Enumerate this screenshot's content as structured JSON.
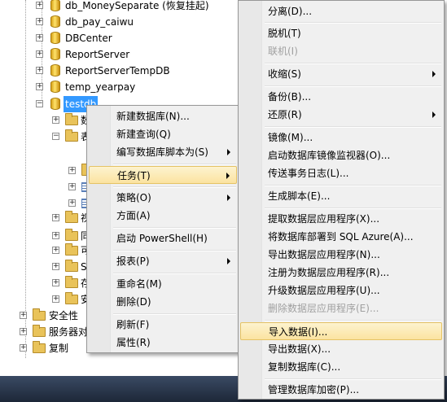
{
  "tree": {
    "items": [
      {
        "label": "db_MoneySeparate (恢复挂起)",
        "kind": "db"
      },
      {
        "label": "db_pay_caiwu",
        "kind": "db"
      },
      {
        "label": "DBCenter",
        "kind": "db"
      },
      {
        "label": "ReportServer",
        "kind": "db"
      },
      {
        "label": "ReportServerTempDB",
        "kind": "db"
      },
      {
        "label": "temp_yearpay",
        "kind": "db"
      },
      {
        "label": "testdb",
        "kind": "db"
      }
    ],
    "children": [
      "数",
      "表",
      "",
      "",
      "",
      "视",
      "同",
      "可",
      "S",
      "存",
      "安"
    ],
    "roots": [
      "安全性",
      "服务器对",
      "复制"
    ],
    "expand_plus": "+",
    "expand_minus": "−",
    "partial_right": "9"
  },
  "context_menu": {
    "items": [
      {
        "label": "新建数据库(N)..."
      },
      {
        "label": "新建查询(Q)"
      },
      {
        "label": "编写数据库脚本为(S)",
        "submenu": true
      },
      {
        "label": "任务(T)",
        "submenu": true,
        "highlighted": true
      },
      {
        "label": "策略(O)",
        "submenu": true
      },
      {
        "label": "方面(A)"
      },
      {
        "label": "启动 PowerShell(H)"
      },
      {
        "label": "报表(P)",
        "submenu": true
      },
      {
        "label": "重命名(M)"
      },
      {
        "label": "删除(D)"
      },
      {
        "label": "刷新(F)"
      },
      {
        "label": "属性(R)"
      }
    ]
  },
  "tasks_menu": {
    "items": [
      {
        "label": "分离(D)..."
      },
      {
        "label": "脱机(T)"
      },
      {
        "label": "联机(I)",
        "disabled": true
      },
      {
        "label": "收缩(S)",
        "submenu": true
      },
      {
        "label": "备份(B)..."
      },
      {
        "label": "还原(R)",
        "submenu": true
      },
      {
        "label": "镜像(M)..."
      },
      {
        "label": "启动数据库镜像监视器(O)..."
      },
      {
        "label": "传送事务日志(L)..."
      },
      {
        "label": "生成脚本(E)..."
      },
      {
        "label": "提取数据层应用程序(X)..."
      },
      {
        "label": "将数据库部署到 SQL Azure(A)..."
      },
      {
        "label": "导出数据层应用程序(N)..."
      },
      {
        "label": "注册为数据层应用程序(R)..."
      },
      {
        "label": "升级数据层应用程序(U)..."
      },
      {
        "label": "删除数据层应用程序(E)...",
        "disabled": true
      },
      {
        "label": "导入数据(I)...",
        "highlighted": true
      },
      {
        "label": "导出数据(X)..."
      },
      {
        "label": "复制数据库(C)..."
      },
      {
        "label": "管理数据库加密(P)..."
      }
    ]
  }
}
